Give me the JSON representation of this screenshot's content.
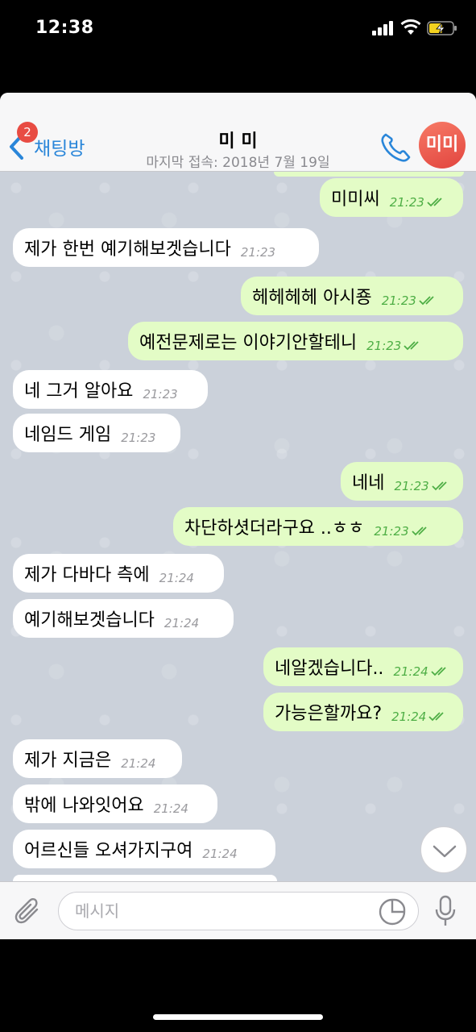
{
  "status_bar": {
    "time": "12:38"
  },
  "header": {
    "back_badge": "2",
    "back_label": "채팅방",
    "title": "미 미",
    "subtitle": "마지막 접속: 2018년 7월 19일",
    "avatar_initials": "미미"
  },
  "messages": [
    {
      "dir": "out",
      "text": "미미씨",
      "time": "21:23",
      "read": true
    },
    {
      "dir": "in",
      "text": "제가 한번 예기해보겟습니다",
      "time": "21:23"
    },
    {
      "dir": "out",
      "text": "헤헤헤헤 아시죵",
      "time": "21:23",
      "read": true
    },
    {
      "dir": "out",
      "text": "예전문제로는 이야기안할테니",
      "time": "21:23",
      "read": true
    },
    {
      "dir": "in",
      "text": "네 그거 알아요",
      "time": "21:23"
    },
    {
      "dir": "in",
      "text": "네임드 게임",
      "time": "21:23"
    },
    {
      "dir": "out",
      "text": "네네",
      "time": "21:23",
      "read": true
    },
    {
      "dir": "out",
      "text": "차단하셧더라구요 ..ㅎㅎ",
      "time": "21:23",
      "read": true
    },
    {
      "dir": "in",
      "text": "제가 다바다 측에",
      "time": "21:24"
    },
    {
      "dir": "in",
      "text": "예기해보겟습니다",
      "time": "21:24"
    },
    {
      "dir": "out",
      "text": "네알겠습니다..",
      "time": "21:24",
      "read": true
    },
    {
      "dir": "out",
      "text": "가능은할까요?",
      "time": "21:24",
      "read": true
    },
    {
      "dir": "in",
      "text": "제가 지금은",
      "time": "21:24"
    },
    {
      "dir": "in",
      "text": "밖에 나와잇어요",
      "time": "21:24"
    },
    {
      "dir": "in",
      "text": "어르신들 오셔가지구여",
      "time": "21:24"
    }
  ],
  "input": {
    "placeholder": "메시지"
  },
  "colors": {
    "accent": "#2a86d9",
    "outgoing_bubble": "#e3fcc6",
    "incoming_bubble": "#ffffff",
    "badge": "#e84c43",
    "read_ticks": "#4eae45"
  }
}
